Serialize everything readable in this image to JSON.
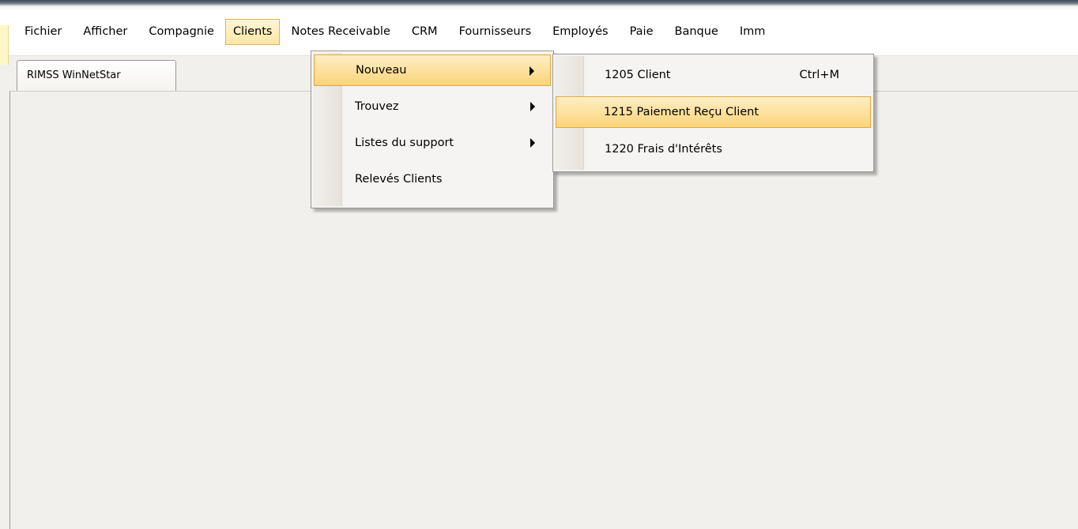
{
  "menubar": {
    "items": [
      {
        "label": "Fichier"
      },
      {
        "label": "Afficher"
      },
      {
        "label": "Compagnie"
      },
      {
        "label": "Clients"
      },
      {
        "label": "Notes Receivable"
      },
      {
        "label": "CRM"
      },
      {
        "label": "Fournisseurs"
      },
      {
        "label": "Employés"
      },
      {
        "label": "Paie"
      },
      {
        "label": "Banque"
      },
      {
        "label": "Imm"
      }
    ],
    "active_item": "Clients"
  },
  "tab": {
    "label": "RIMSS WinNetStar"
  },
  "clients_menu": {
    "items": [
      {
        "label": "Nouveau",
        "has_submenu": true
      },
      {
        "label": "Trouvez",
        "has_submenu": true
      },
      {
        "label": "Listes du support",
        "has_submenu": true
      },
      {
        "label": "Relevés Clients",
        "has_submenu": false
      }
    ]
  },
  "nouveau_submenu": {
    "items": [
      {
        "label": "1205 Client",
        "shortcut": "Ctrl+M"
      },
      {
        "label": "1215 Paiement Reçu Client",
        "shortcut": ""
      },
      {
        "label": "1220 Frais d'Intérêts",
        "shortcut": ""
      }
    ]
  },
  "colors": {
    "highlight_fill": "#fbd47a",
    "highlight_border": "#e2a83a",
    "background": "#f2f0ec"
  }
}
